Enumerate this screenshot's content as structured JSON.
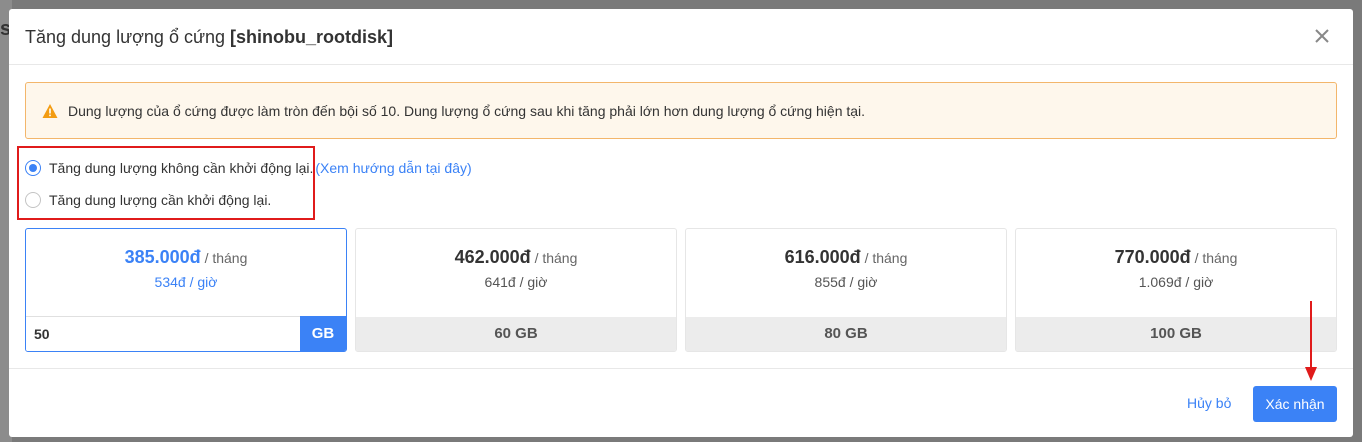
{
  "backdrop": {
    "letter": "s"
  },
  "modal": {
    "title_prefix": "Tăng dung lượng ổ cứng ",
    "title_disk": "[shinobu_rootdisk]"
  },
  "alert": {
    "icon": "warning-icon",
    "text": "Dung lượng của ổ cứng được làm tròn đến bội số 10. Dung lượng ổ cứng sau khi tăng phải lớn hơn dung lượng ổ cứng hiện tại."
  },
  "options": [
    {
      "label": "Tăng dung lượng không cần khởi động lại.",
      "checked": true,
      "link": "(Xem hướng dẫn tại đây)"
    },
    {
      "label": "Tăng dung lượng cần khởi động lại.",
      "checked": false
    }
  ],
  "plans": [
    {
      "price": "385.000đ",
      "per": "/ tháng",
      "hourly": "534đ / giờ",
      "input_value": "50",
      "unit": "GB",
      "selected": true
    },
    {
      "price": "462.000đ",
      "per": "/ tháng",
      "hourly": "641đ / giờ",
      "size": "60 GB",
      "selected": false
    },
    {
      "price": "616.000đ",
      "per": "/ tháng",
      "hourly": "855đ / giờ",
      "size": "80 GB",
      "selected": false
    },
    {
      "price": "770.000đ",
      "per": "/ tháng",
      "hourly": "1.069đ / giờ",
      "size": "100 GB",
      "selected": false
    }
  ],
  "footer": {
    "cancel_label": "Hủy bỏ",
    "confirm_label": "Xác nhận"
  },
  "colors": {
    "accent": "#3b82f6",
    "annotation_red": "#e01b1b",
    "alert_border": "#f3b66b",
    "alert_bg": "#fef7ec",
    "warning_icon": "#f39c12"
  }
}
